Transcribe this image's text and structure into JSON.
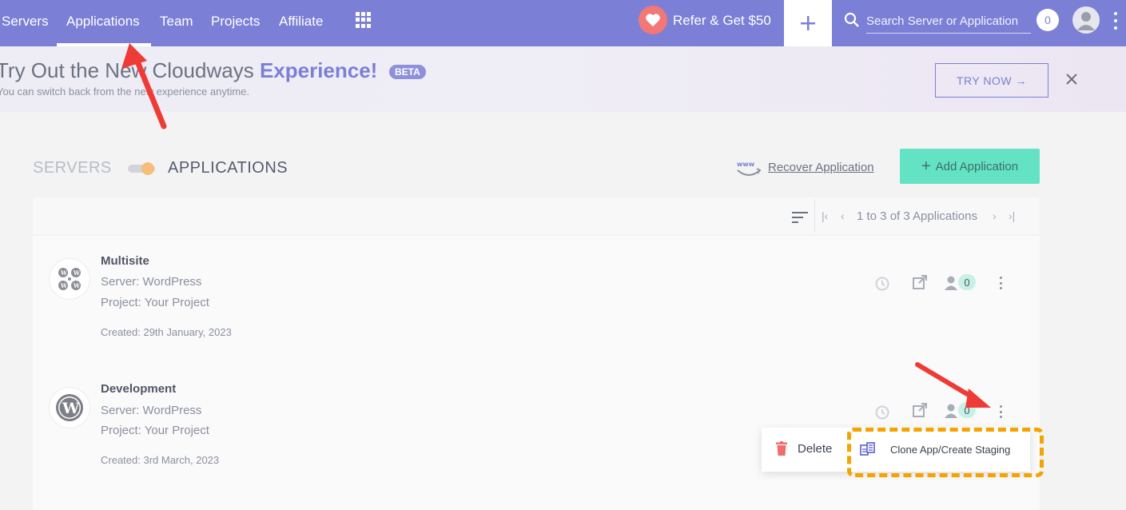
{
  "nav": {
    "links": [
      "Servers",
      "Applications",
      "Team",
      "Projects",
      "Affiliate"
    ],
    "refer_label": "Refer & Get $50",
    "search_placeholder": "Search Server or Application",
    "notification_count": "0"
  },
  "banner": {
    "title_prefix": "Try Out the New Cloudways ",
    "title_accent": "Experience!",
    "beta_label": "BETA",
    "subtitle": "You can switch back from the new experience anytime.",
    "try_label": "TRY NOW →"
  },
  "toolbar": {
    "servers_label": "SERVERS",
    "applications_label": "APPLICATIONS",
    "recover_label": "Recover Application",
    "add_label": "Add Application"
  },
  "pager": {
    "text": "1 to 3 of 3 Applications"
  },
  "apps": [
    {
      "name": "Multisite",
      "server": "Server: WordPress",
      "project": "Project: Your Project",
      "created": "Created: 29th January, 2023",
      "team_count": "0",
      "icon": "wordpress-multisite-icon"
    },
    {
      "name": "Development",
      "server": "Server: WordPress",
      "project": "Project: Your Project",
      "created": "Created: 3rd March, 2023",
      "team_count": "0",
      "icon": "wordpress-icon"
    }
  ],
  "menu": {
    "delete_label": "Delete",
    "clone_label": "Clone App/Create Staging"
  },
  "colors": {
    "nav_bg": "#7b7fd6",
    "accent_green": "#63e2c4",
    "highlight_box": "#f5a300",
    "annotation_arrow": "#ef3b36"
  }
}
